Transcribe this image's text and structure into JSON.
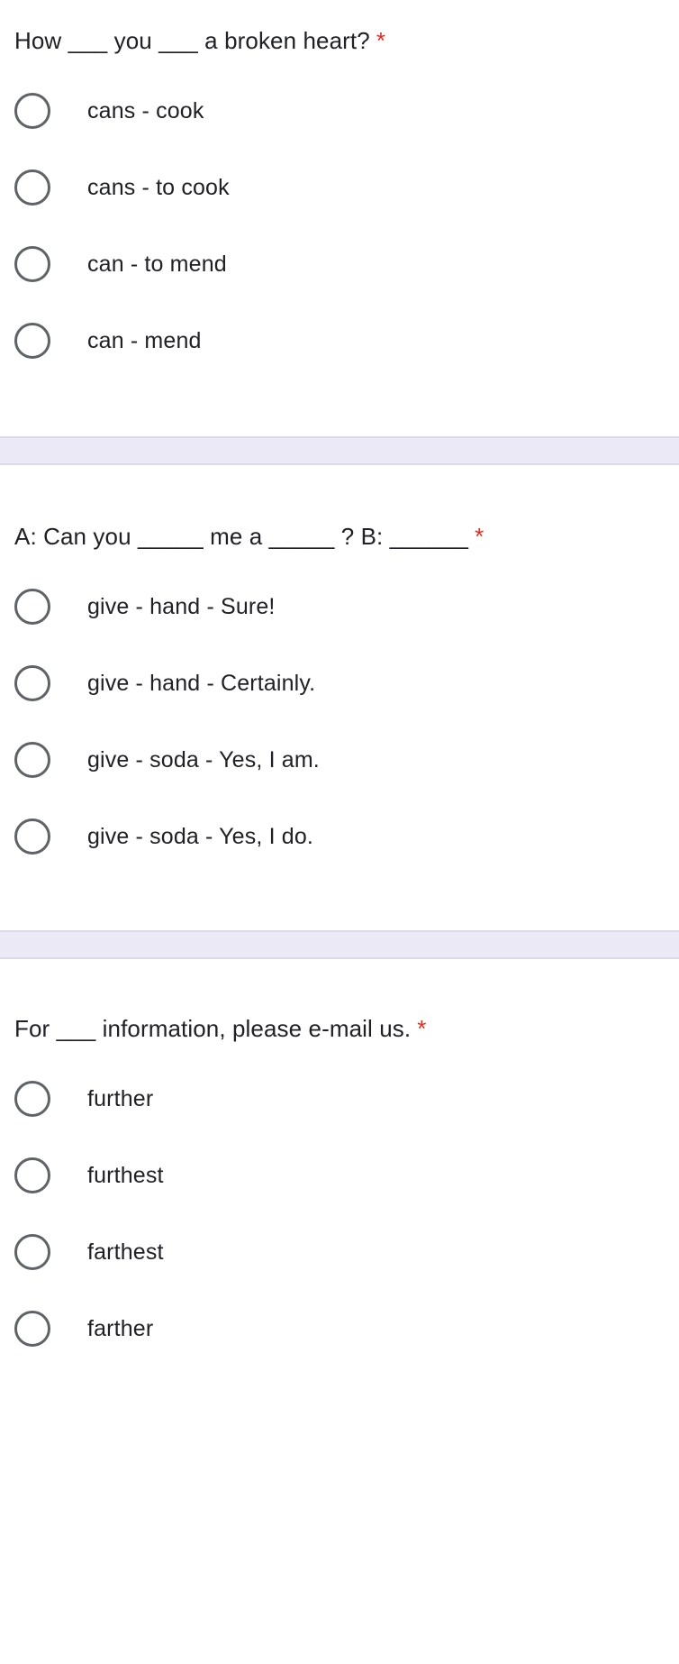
{
  "form": {
    "required_marker": "*",
    "required_marker_color": "#d93025",
    "question_text_color": "#202124",
    "radio_stroke_color": "#5f6368",
    "card_background": "#ffffff",
    "separator_color": "#ece9f6",
    "separator_border_color": "#dddae6"
  },
  "questions": [
    {
      "id": "q1",
      "title": "How ___ you ___ a broken heart?",
      "required": true,
      "selected": null,
      "options": [
        {
          "label": "cans - cook",
          "selected": false
        },
        {
          "label": "cans - to cook",
          "selected": false
        },
        {
          "label": "can - to mend",
          "selected": false
        },
        {
          "label": "can - mend",
          "selected": false
        }
      ]
    },
    {
      "id": "q2",
      "title": "A: Can you _____ me a _____ ? B: ______",
      "required": true,
      "selected": null,
      "options": [
        {
          "label": "give - hand - Sure!",
          "selected": false
        },
        {
          "label": "give - hand - Certainly.",
          "selected": false
        },
        {
          "label": "give - soda - Yes, I am.",
          "selected": false
        },
        {
          "label": "give - soda - Yes, I do.",
          "selected": false
        }
      ]
    },
    {
      "id": "q3",
      "title": "For ___ information, please e-mail us.",
      "required": true,
      "selected": null,
      "options": [
        {
          "label": "further",
          "selected": false
        },
        {
          "label": "furthest",
          "selected": false
        },
        {
          "label": "farthest",
          "selected": false
        },
        {
          "label": "farther",
          "selected": false
        }
      ]
    }
  ]
}
